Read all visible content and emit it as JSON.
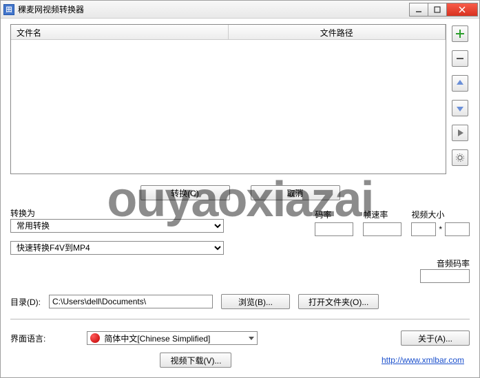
{
  "titlebar": {
    "title": "稞麦网视频转换器"
  },
  "list": {
    "col_name": "文件名",
    "col_path": "文件路径"
  },
  "side": {
    "add": "add-icon",
    "remove": "remove-icon",
    "up": "up-icon",
    "down": "down-icon",
    "play": "play-icon",
    "settings": "gear-icon"
  },
  "actions": {
    "convert": "转换(C)",
    "cancel": "取消"
  },
  "convert": {
    "label": "转换为",
    "mode": "常用转换",
    "preset": "快速转换F4V到MP4"
  },
  "rates": {
    "bitrate_label": "码率",
    "bitrate": "",
    "fps_label": "帧速率",
    "fps": "",
    "size_label": "视频大小",
    "w": "",
    "h": "",
    "sep": "*",
    "audio_label": "音频码率",
    "audio": ""
  },
  "dir": {
    "label": "目录(D):",
    "path": "C:\\Users\\dell\\Documents\\",
    "browse": "浏览(B)...",
    "open": "打开文件夹(O)..."
  },
  "lang": {
    "label": "界面语言:",
    "value": "简体中文[Chinese Simplified]",
    "about": "关于(A)..."
  },
  "footer": {
    "download": "视频下载(V)...",
    "link": "http://www.xmlbar.com"
  },
  "watermark": "ouyaoxiazai"
}
